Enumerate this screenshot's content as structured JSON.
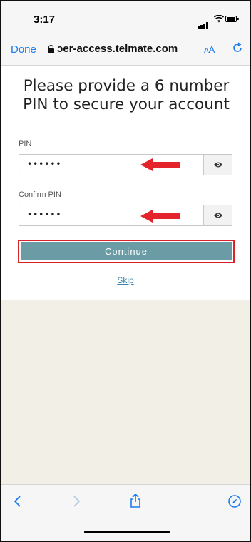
{
  "status_bar": {
    "time": "3:17"
  },
  "browser": {
    "done_label": "Done",
    "url": "ɔer-access.telmate.com",
    "text_size_label": "AA"
  },
  "page": {
    "headline": "Please provide a 6 number PIN to secure your account",
    "pin": {
      "label": "PIN",
      "value": "••••••"
    },
    "confirm_pin": {
      "label": "Confirm PIN",
      "value": "••••••"
    },
    "continue_label": "Continue",
    "skip_label": "Skip"
  },
  "annotations": {
    "arrow_color": "#e5232a",
    "highlight_color": "#d9232a"
  },
  "colors": {
    "accent": "#1b7bef",
    "button": "#6b9ba4",
    "link": "#3a86a8",
    "background": "#f2efe6"
  },
  "icons": [
    "lock-icon",
    "refresh-icon",
    "eye-icon",
    "back-icon",
    "forward-icon",
    "share-icon",
    "compass-icon"
  ]
}
